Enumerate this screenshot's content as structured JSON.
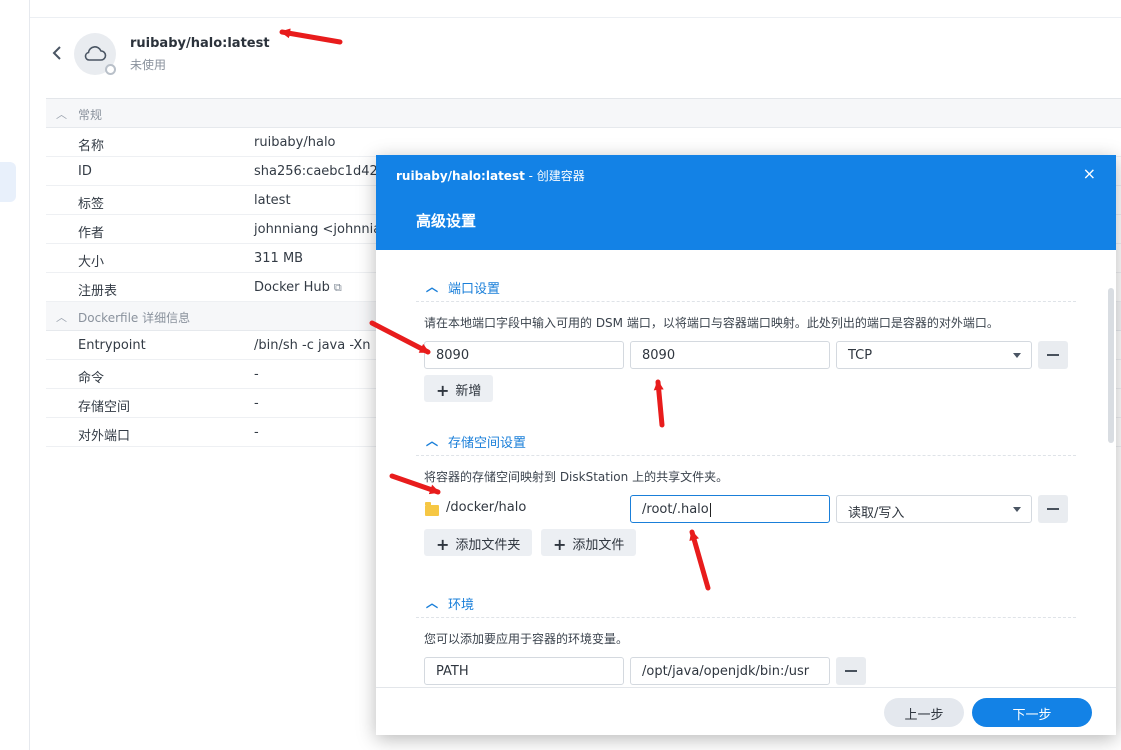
{
  "header": {
    "title": "ruibaby/halo:latest",
    "status": "未使用"
  },
  "general": {
    "section_label": "常规",
    "rows": [
      {
        "key": "名称",
        "value": "ruibaby/halo"
      },
      {
        "key": "ID",
        "value": "sha256:caebc1d42"
      },
      {
        "key": "标签",
        "value": "latest"
      },
      {
        "key": "作者",
        "value": "johnniang <johnnia"
      },
      {
        "key": "大小",
        "value": "311 MB"
      },
      {
        "key": "注册表",
        "value": "Docker Hub"
      }
    ]
  },
  "dockerfile": {
    "section_label": "Dockerfile 详细信息",
    "rows": [
      {
        "key": "Entrypoint",
        "value": "/bin/sh -c java -Xn"
      },
      {
        "key": "命令",
        "value": "-"
      },
      {
        "key": "存储空间",
        "value": "-"
      },
      {
        "key": "对外端口",
        "value": "-"
      }
    ]
  },
  "dialog": {
    "title_name": "ruibaby/halo:latest",
    "title_suffix": " - 创建容器",
    "heading": "高级设置",
    "close_icon": "×",
    "ports": {
      "label": "端口设置",
      "desc": "请在本地端口字段中输入可用的 DSM 端口，以将端口与容器端口映射。此处列出的端口是容器的对外端口。",
      "local_port": "8090",
      "container_port": "8090",
      "protocol": "TCP",
      "add_label": "新增"
    },
    "storage": {
      "label": "存储空间设置",
      "desc": "将容器的存储空间映射到 DiskStation 上的共享文件夹。",
      "folder": "/docker/halo",
      "mount_path": "/root/.halo",
      "mode": "读取/写入",
      "add_folder_label": "添加文件夹",
      "add_file_label": "添加文件"
    },
    "env": {
      "label": "环境",
      "desc": "您可以添加要应用于容器的环境变量。",
      "var_name": "PATH",
      "var_value": "/opt/java/openjdk/bin:/usr"
    },
    "footer": {
      "prev_label": "上一步",
      "next_label": "下一步"
    }
  },
  "colors": {
    "accent": "#1382e6",
    "annotation_arrow": "#e81c1c"
  }
}
